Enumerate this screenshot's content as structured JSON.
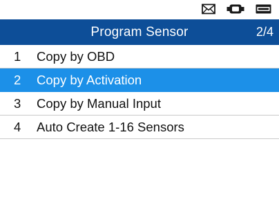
{
  "status_bar": {
    "icons": [
      "envelope-icon",
      "vehicle-link-icon",
      "battery-icon"
    ]
  },
  "header": {
    "title": "Program Sensor",
    "page_indicator": "2/4"
  },
  "menu": {
    "items": [
      {
        "number": "1",
        "label": "Copy by OBD",
        "selected": false
      },
      {
        "number": "2",
        "label": "Copy by Activation",
        "selected": true
      },
      {
        "number": "3",
        "label": "Copy by Manual Input",
        "selected": false
      },
      {
        "number": "4",
        "label": "Auto Create 1-16 Sensors",
        "selected": false
      }
    ]
  },
  "colors": {
    "title_bar": "#0d4e98",
    "selected_row": "#1c90e8",
    "divider": "#c9c9c9"
  }
}
